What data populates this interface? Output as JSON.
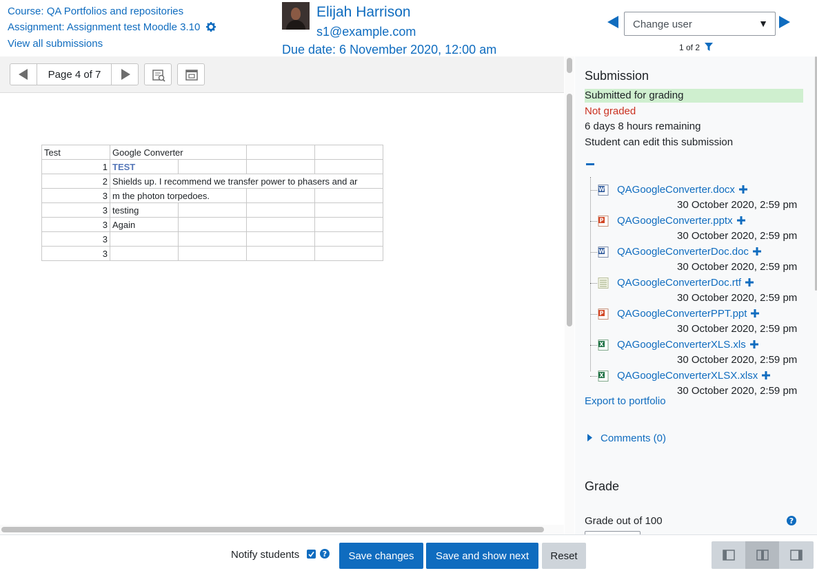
{
  "header": {
    "course_link": "Course: QA Portfolios and repositories",
    "assignment_link": "Assignment: Assignment test Moodle 3.10",
    "view_all_link": "View all submissions",
    "user_name": "Elijah Harrison",
    "user_email": "s1@example.com",
    "due_date": "Due date: 6 November 2020, 12:00 am",
    "change_user_placeholder": "Change user",
    "change_user_caret": "▼",
    "counter": "1 of 2"
  },
  "toolbar": {
    "page_label": "Page 4 of 7"
  },
  "sheet": {
    "rows": [
      [
        "Test",
        "Google Converter",
        "",
        "",
        ""
      ],
      [
        "1",
        "TEST",
        "",
        "",
        ""
      ],
      [
        "2",
        "Shields up. I recommend we transfer power to phasers and ar",
        "",
        "",
        ""
      ],
      [
        "3",
        "m the photon torpedoes.",
        "",
        "",
        ""
      ],
      [
        "3",
        "testing",
        "",
        "",
        ""
      ],
      [
        "3",
        "Again",
        "",
        "",
        ""
      ],
      [
        "3",
        "",
        "",
        "",
        ""
      ],
      [
        "3",
        "",
        "",
        "",
        ""
      ]
    ]
  },
  "submission": {
    "heading": "Submission",
    "status_submitted": "Submitted for grading",
    "status_graded": "Not graded",
    "time_remaining": "6 days 8 hours remaining",
    "edit_status": "Student can edit this submission",
    "files": [
      {
        "name": "QAGoogleConverter.docx",
        "date": "30 October 2020, 2:59 pm",
        "icon": "word-file-icon"
      },
      {
        "name": "QAGoogleConverter.pptx",
        "date": "30 October 2020, 2:59 pm",
        "icon": "powerpoint-file-icon"
      },
      {
        "name": "QAGoogleConverterDoc.doc",
        "date": "30 October 2020, 2:59 pm",
        "icon": "word-file-icon"
      },
      {
        "name": "QAGoogleConverterDoc.rtf",
        "date": "30 October 2020, 2:59 pm",
        "icon": "text-file-icon"
      },
      {
        "name": "QAGoogleConverterPPT.ppt",
        "date": "30 October 2020, 2:59 pm",
        "icon": "powerpoint-file-icon"
      },
      {
        "name": "QAGoogleConverterXLS.xls",
        "date": "30 October 2020, 2:59 pm",
        "icon": "excel-file-icon"
      },
      {
        "name": "QAGoogleConverterXLSX.xlsx",
        "date": "30 October 2020, 2:59 pm",
        "icon": "excel-file-icon"
      }
    ],
    "export_link": "Export to portfolio",
    "comments_link": "Comments (0)"
  },
  "grade": {
    "heading": "Grade",
    "grade_out_of": "Grade out of 100"
  },
  "footer": {
    "notify_label": "Notify students",
    "save_label": "Save changes",
    "save_next_label": "Save and show next",
    "reset_label": "Reset"
  },
  "colors": {
    "link": "#0f6cbf",
    "submitted_bg": "#cfefcf",
    "not_graded": "#ca3120"
  }
}
